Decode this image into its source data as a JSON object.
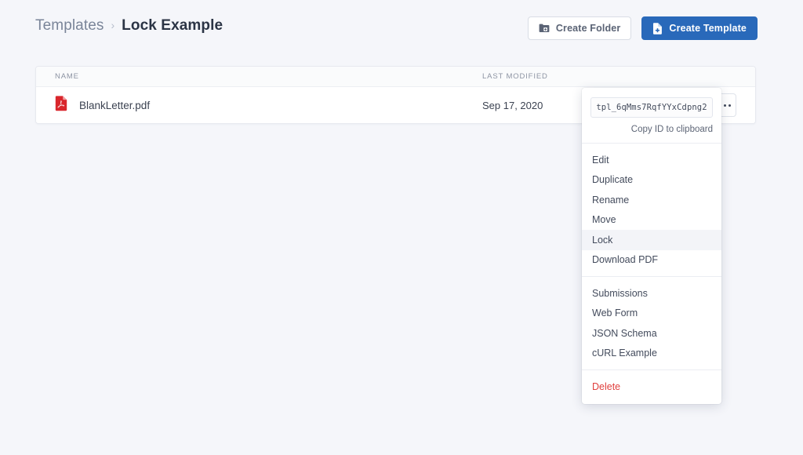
{
  "breadcrumb": {
    "root_label": "Templates",
    "separator": "›",
    "current_label": "Lock Example"
  },
  "header": {
    "create_folder_label": "Create Folder",
    "create_folder_icon": "folder-plus-icon",
    "create_template_label": "Create Template",
    "create_template_icon": "file-plus-icon",
    "primary_color": "#2969ba"
  },
  "table": {
    "columns": [
      "NAME",
      "LAST MODIFIED"
    ],
    "rows": [
      {
        "icon": "pdf-file-icon",
        "name": "BlankLetter.pdf",
        "last_modified": "Sep 17, 2020",
        "actions_icon": "kebab-menu-icon"
      }
    ]
  },
  "context_menu": {
    "template_id": "tpl_6qMms7RqfYYxCdpng2",
    "copy_label": "Copy ID to clipboard",
    "groups": [
      {
        "items": [
          {
            "label": "Edit",
            "active": false
          },
          {
            "label": "Duplicate",
            "active": false
          },
          {
            "label": "Rename",
            "active": false
          },
          {
            "label": "Move",
            "active": false
          },
          {
            "label": "Lock",
            "active": true
          },
          {
            "label": "Download PDF",
            "active": false
          }
        ]
      },
      {
        "items": [
          {
            "label": "Submissions",
            "active": false
          },
          {
            "label": "Web Form",
            "active": false
          },
          {
            "label": "JSON Schema",
            "active": false
          },
          {
            "label": "cURL Example",
            "active": false
          }
        ]
      },
      {
        "items": [
          {
            "label": "Delete",
            "active": false,
            "danger": true
          }
        ]
      }
    ],
    "danger_color": "#e0403e",
    "highlight_color": "#f3f4f8"
  }
}
